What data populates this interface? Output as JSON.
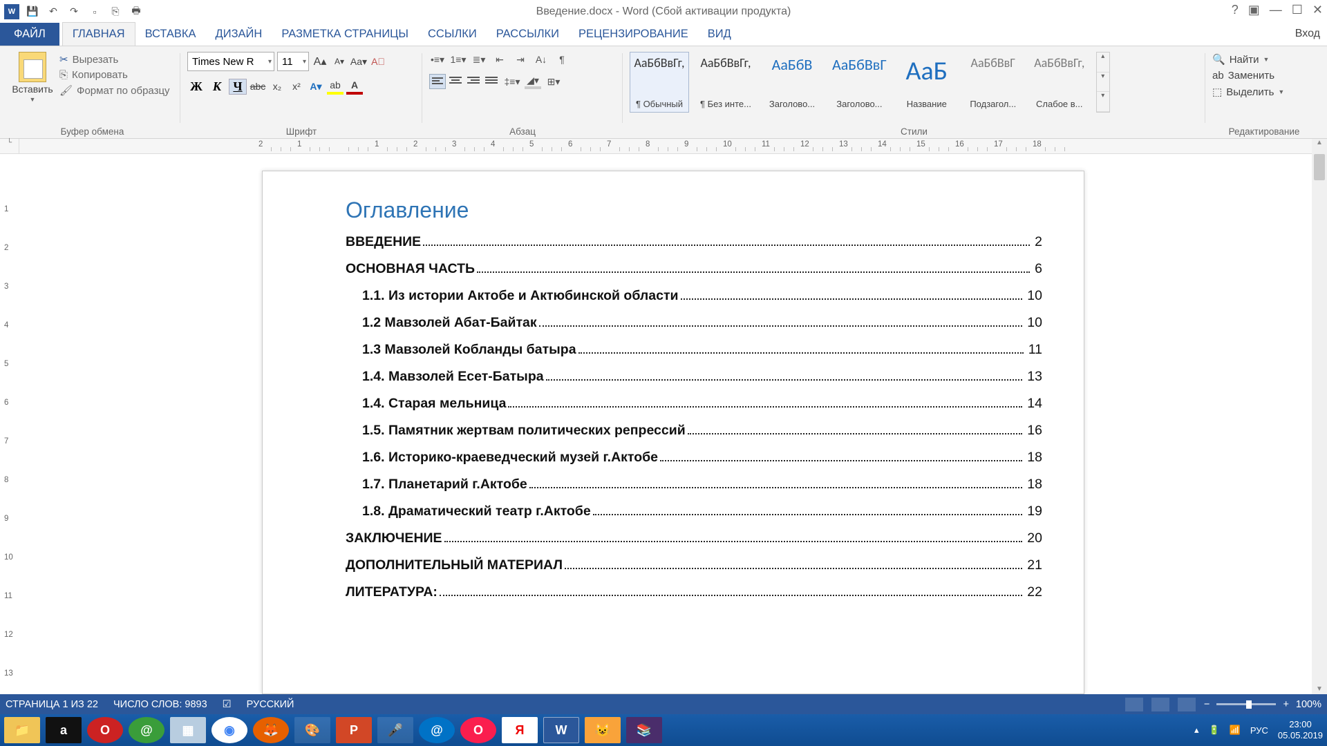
{
  "title": "Введение.docx - Word (Сбой активации продукта)",
  "qat": {
    "undo": "↶",
    "redo": "↷"
  },
  "tabs": {
    "file": "ФАЙЛ",
    "list": [
      "ГЛАВНАЯ",
      "ВСТАВКА",
      "ДИЗАЙН",
      "РАЗМЕТКА СТРАНИЦЫ",
      "ССЫЛКИ",
      "РАССЫЛКИ",
      "РЕЦЕНЗИРОВАНИЕ",
      "ВИД"
    ],
    "active": 0,
    "login": "Вход"
  },
  "clipboard": {
    "paste": "Вставить",
    "cut": "Вырезать",
    "copy": "Копировать",
    "format": "Формат по образцу",
    "group": "Буфер обмена"
  },
  "font": {
    "name": "Times New R",
    "size": "11",
    "group": "Шрифт",
    "bold": "Ж",
    "italic": "К",
    "underline": "Ч",
    "strike": "abc",
    "sub": "x₂",
    "sup": "x²"
  },
  "para": {
    "group": "Абзац"
  },
  "styles": {
    "group": "Стили",
    "items": [
      {
        "preview": "АаБбВвГг,",
        "name": "¶ Обычный",
        "cls": ""
      },
      {
        "preview": "АаБбВвГг,",
        "name": "¶ Без инте...",
        "cls": ""
      },
      {
        "preview": "АаБбВ",
        "name": "Заголово...",
        "cls": "blue"
      },
      {
        "preview": "АаБбВвГ",
        "name": "Заголово...",
        "cls": "blue"
      },
      {
        "preview": "АаБ",
        "name": "Название",
        "cls": "big"
      },
      {
        "preview": "АаБбВвГ",
        "name": "Подзагол...",
        "cls": "gray"
      },
      {
        "preview": "АаБбВвГг,",
        "name": "Слабое в...",
        "cls": "gray"
      }
    ]
  },
  "editing": {
    "group": "Редактирование",
    "find": "Найти",
    "replace": "Заменить",
    "select": "Выделить"
  },
  "doc": {
    "toc_title": "Оглавление",
    "entries": [
      {
        "text": "ВВЕДЕНИЕ",
        "page": "2",
        "sub": false
      },
      {
        "text": "ОСНОВНАЯ ЧАСТЬ",
        "page": "6",
        "sub": false
      },
      {
        "text": "1.1. Из истории Актобе и Актюбинской области",
        "page": "10",
        "sub": true
      },
      {
        "text": "1.2 Мавзолей Абат-Байтак",
        "page": "10",
        "sub": true
      },
      {
        "text": "1.3 Мавзолей Кобланды батыра",
        "page": "11",
        "sub": true
      },
      {
        "text": "1.4. Мавзолей Есет-Батыра",
        "page": "13",
        "sub": true
      },
      {
        "text": "1.4. Старая мельница",
        "page": "14",
        "sub": true
      },
      {
        "text": "1.5. Памятник жертвам политических репрессий",
        "page": "16",
        "sub": true
      },
      {
        "text": "1.6. Историко-краеведческий музей г.Актобе",
        "page": "18",
        "sub": true
      },
      {
        "text": "1.7. Планетарий г.Актобе",
        "page": "18",
        "sub": true
      },
      {
        "text": "1.8. Драматический театр г.Актобе",
        "page": "19",
        "sub": true
      },
      {
        "text": "ЗАКЛЮЧЕНИЕ",
        "page": "20",
        "sub": false
      },
      {
        "text": "ДОПОЛНИТЕЛЬНЫЙ МАТЕРИАЛ",
        "page": "21",
        "sub": false
      },
      {
        "text": "ЛИТЕРАТУРА:",
        "page": "22",
        "sub": false
      }
    ]
  },
  "status": {
    "page": "СТРАНИЦА 1 ИЗ 22",
    "words": "ЧИСЛО СЛОВ: 9893",
    "lang": "РУССКИЙ",
    "zoom": "100%"
  },
  "taskbar": {
    "time": "23:00",
    "date": "05.05.2019",
    "lang": "РУС"
  },
  "hruler_labels": [
    "2",
    "1",
    "",
    "1",
    "2",
    "3",
    "4",
    "5",
    "6",
    "7",
    "8",
    "9",
    "10",
    "11",
    "12",
    "13",
    "14",
    "15",
    "16",
    "17",
    "18"
  ],
  "vruler_labels": [
    "",
    "1",
    "2",
    "3",
    "4",
    "5",
    "6",
    "7",
    "8",
    "9",
    "10",
    "11",
    "12",
    "13"
  ]
}
